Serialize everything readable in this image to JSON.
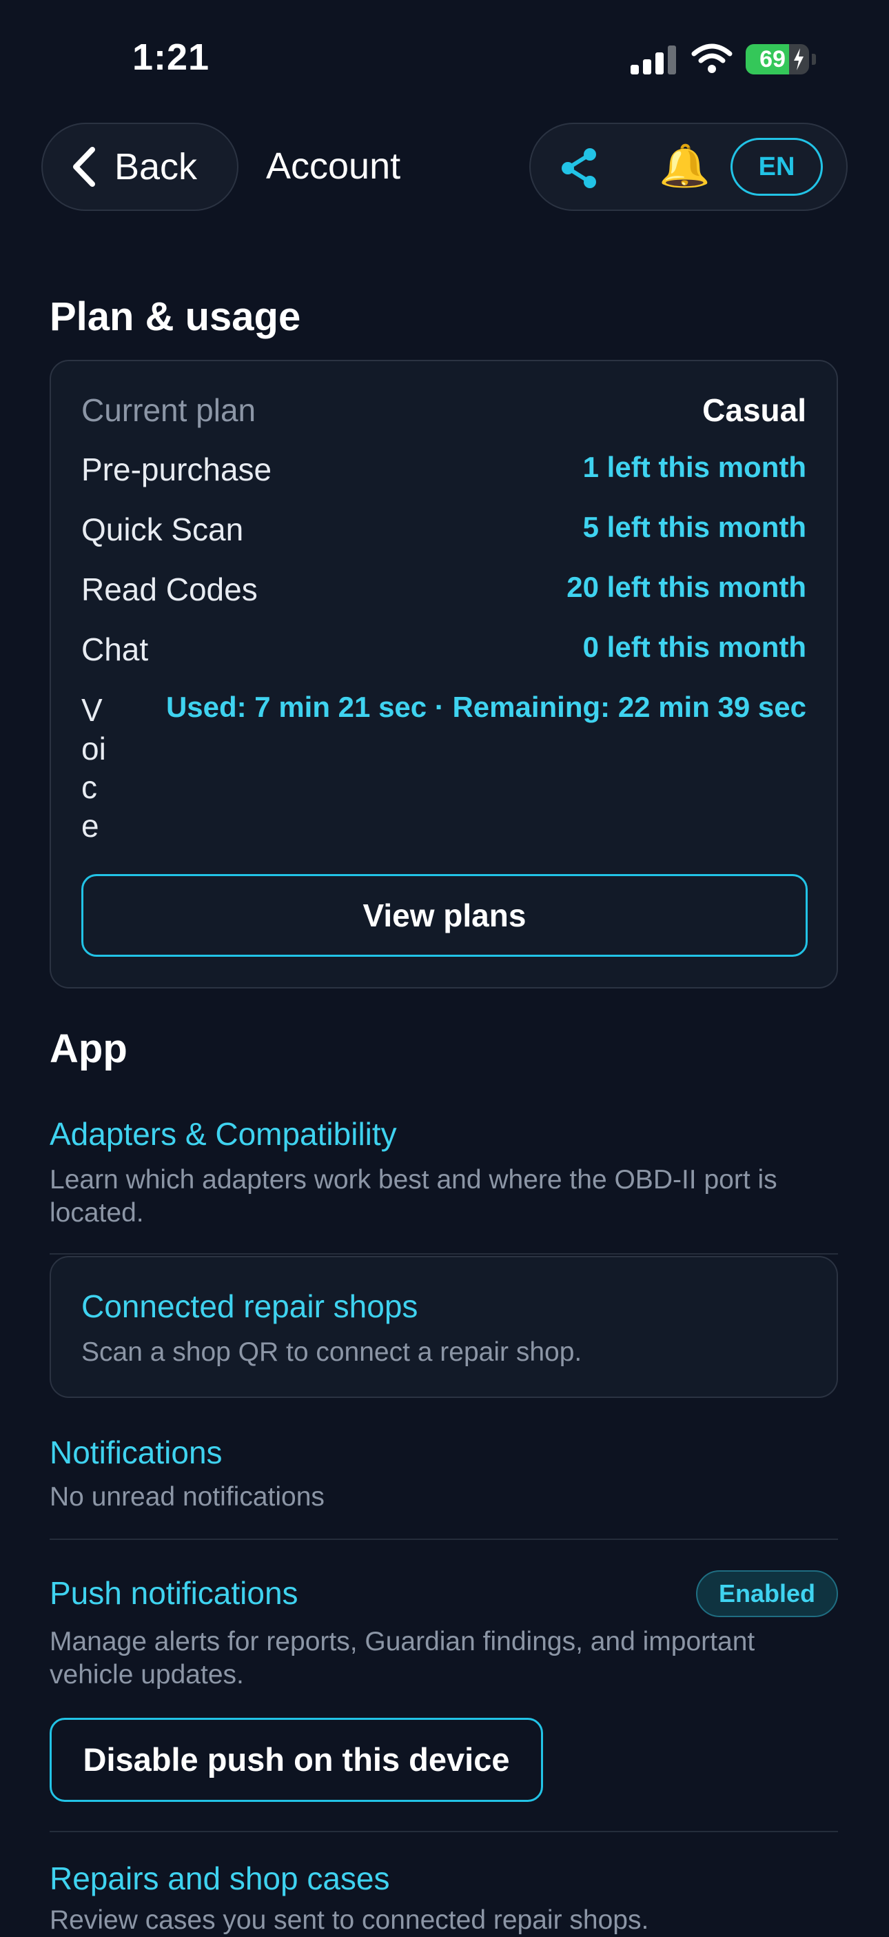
{
  "status_bar": {
    "time": "1:21",
    "battery_level": "69",
    "battery_fraction": 0.69
  },
  "header": {
    "back_label": "Back",
    "title": "Account",
    "language": "EN",
    "bell_glyph": "🔔"
  },
  "plan_usage": {
    "section_title": "Plan & usage",
    "current_plan_label": "Current plan",
    "current_plan_value": "Casual",
    "rows": [
      {
        "label": "Pre-purchase",
        "value": "1 left this month"
      },
      {
        "label": "Quick Scan",
        "value": "5 left this month"
      },
      {
        "label": "Read Codes",
        "value": "20 left this month"
      },
      {
        "label": "Chat",
        "value": "0 left this month"
      }
    ],
    "voice_label": "Voice",
    "voice_value": "Used: 7 min 21 sec · Remaining: 22 min 39 sec",
    "view_plans_label": "View plans"
  },
  "app": {
    "section_title": "App",
    "adapters": {
      "title": "Adapters & Compatibility",
      "description": "Learn which adapters work best and where the OBD-II port is located."
    },
    "repair_shops": {
      "title": "Connected repair shops",
      "description": "Scan a shop QR to connect a repair shop."
    },
    "notifications": {
      "title": "Notifications",
      "description": "No unread notifications"
    },
    "push": {
      "title": "Push notifications",
      "status_badge": "Enabled",
      "description": "Manage alerts for reports, Guardian findings, and important vehicle updates.",
      "disable_label": "Disable push on this device"
    },
    "repairs": {
      "title": "Repairs and shop cases",
      "description": "Review cases you sent to connected repair shops."
    }
  },
  "colors": {
    "background": "#0d1321",
    "accent": "#22c3e6",
    "card": "#121a28",
    "muted_text": "#8c96a6"
  },
  "icons": [
    "chevron-left-icon",
    "share-icon",
    "bell-icon",
    "signal-icon",
    "wifi-icon",
    "battery-icon"
  ]
}
